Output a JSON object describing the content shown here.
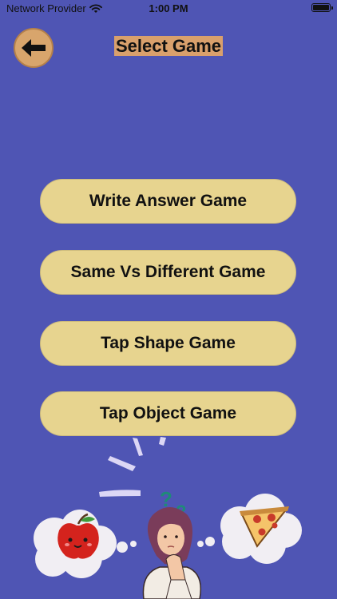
{
  "status_bar": {
    "carrier": "Network Provider",
    "time": "1:00 PM",
    "battery_level": 1.0,
    "icons": [
      "wifi-icon",
      "battery-icon"
    ]
  },
  "header": {
    "back_icon": "arrow-left-icon",
    "title": "Select Game"
  },
  "games": [
    {
      "label": "Write Answer Game"
    },
    {
      "label": "Same Vs Different Game"
    },
    {
      "label": "Tap Shape Game"
    },
    {
      "label": "Tap Object Game"
    }
  ],
  "illustration": {
    "question_marks": [
      "?",
      "?"
    ],
    "thought_left": "apple-icon",
    "thought_right": "pizza-icon"
  },
  "colors": {
    "background": "#4f55b4",
    "button": "#e7d48f",
    "title_highlight": "#d9a06c",
    "back_button": "#d8a56c"
  }
}
